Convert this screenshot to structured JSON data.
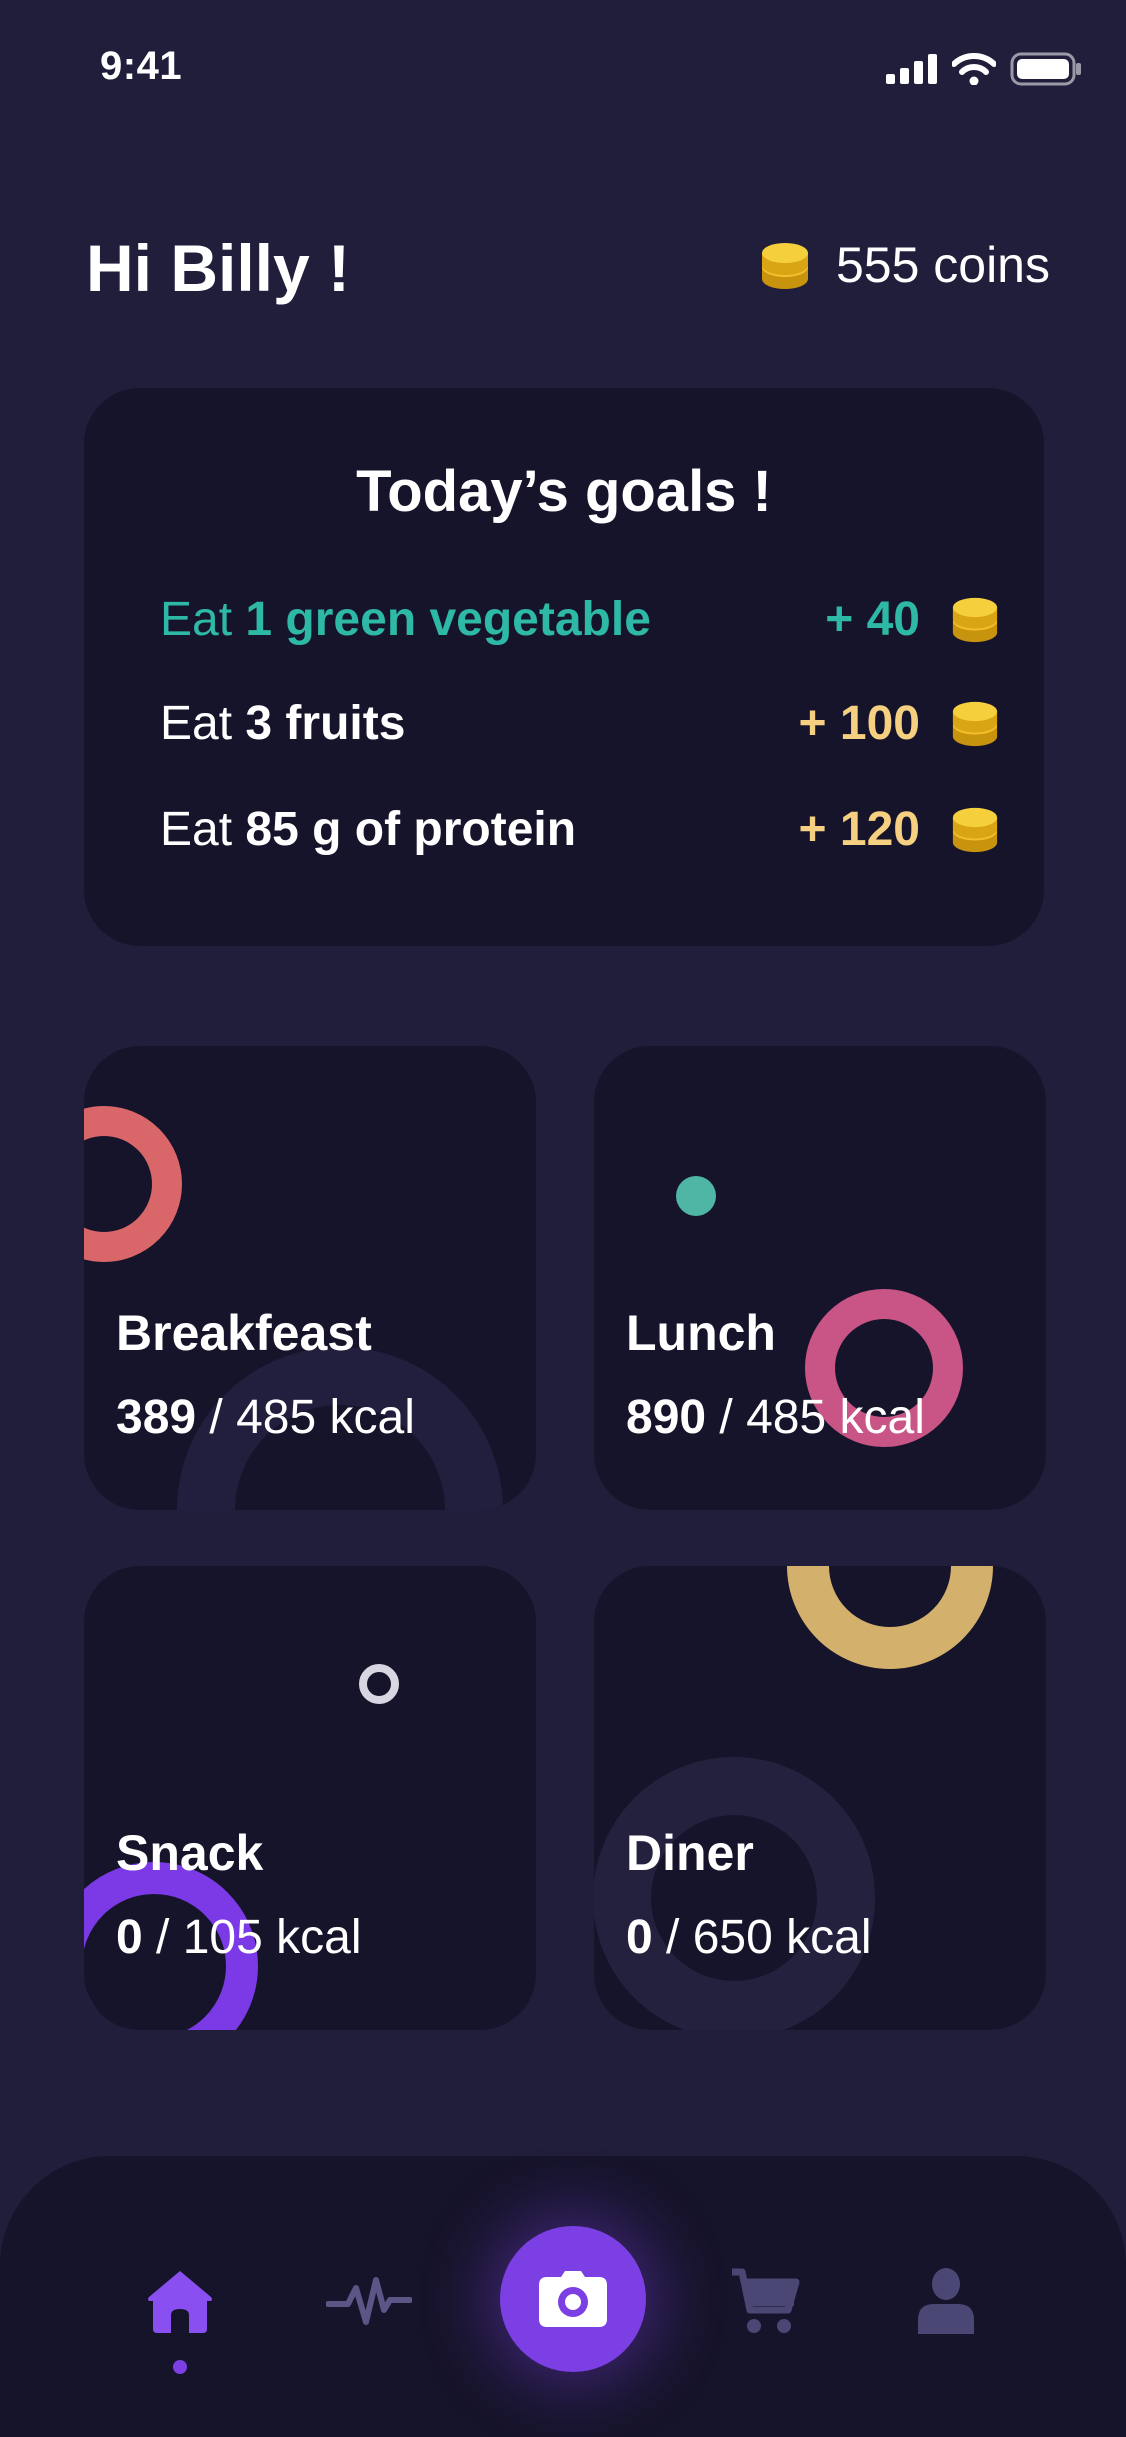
{
  "status_bar": {
    "time": "9:41"
  },
  "header": {
    "greeting": "Hi Billy !",
    "coins_label": "555 coins",
    "coin_icon": "coins-icon"
  },
  "goals": {
    "title": "Today’s goals !",
    "items": [
      {
        "prefix": "Eat ",
        "bold": "1 green vegetable",
        "suffix": "",
        "reward": "+ 40",
        "status": "done"
      },
      {
        "prefix": "Eat ",
        "bold": "3 fruits",
        "suffix": "",
        "reward": "+ 100",
        "status": "pending"
      },
      {
        "prefix": "Eat ",
        "bold": "85 g of protein",
        "suffix": "",
        "reward": "+ 120",
        "status": "pending"
      }
    ]
  },
  "meals": [
    {
      "name": "Breakfeast",
      "consumed": "389",
      "target": " / 485 kcal"
    },
    {
      "name": "Lunch",
      "consumed": "890",
      "target": " / 485 kcal"
    },
    {
      "name": "Snack",
      "consumed": "0",
      "target": " / 105 kcal"
    },
    {
      "name": "Diner",
      "consumed": "0",
      "target": " / 650 kcal"
    }
  ],
  "nav": {
    "items": [
      "home-icon",
      "activity-icon",
      "camera-icon",
      "cart-icon",
      "profile-icon"
    ],
    "active": "home-icon"
  },
  "colors": {
    "background": "#201e3a",
    "card": "#16142a",
    "accent": "#7c3fe4",
    "done": "#2eb8a6",
    "reward": "#f6d081",
    "coin": "#f2c12e"
  }
}
